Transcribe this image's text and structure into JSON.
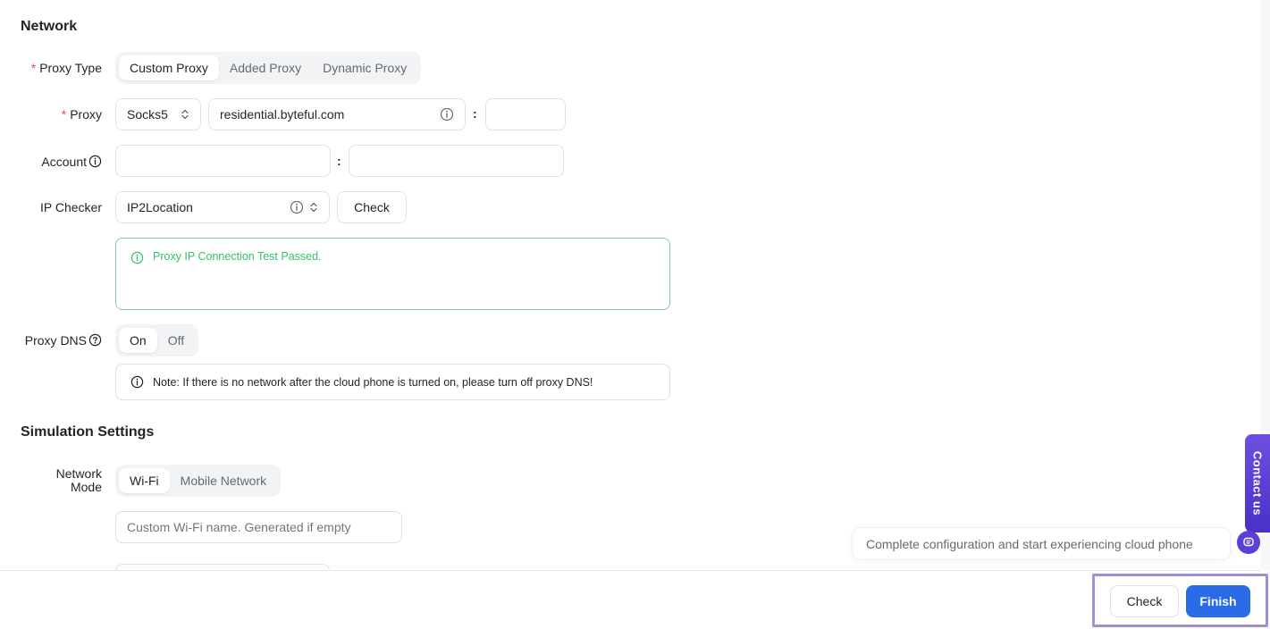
{
  "network": {
    "title": "Network",
    "proxy_type": {
      "label": "Proxy Type",
      "required_mark": "*",
      "options": [
        "Custom Proxy",
        "Added Proxy",
        "Dynamic Proxy"
      ],
      "selected": "Custom Proxy"
    },
    "proxy": {
      "label": "Proxy",
      "required_mark": "*",
      "protocol": "Socks5",
      "host": "residential.byteful.com",
      "port": "",
      "colon": ":"
    },
    "account": {
      "label": "Account",
      "username": "",
      "password": "",
      "colon": ":"
    },
    "ip_checker": {
      "label": "IP Checker",
      "value": "IP2Location",
      "check_label": "Check"
    },
    "test_result": {
      "message": "Proxy IP Connection Test Passed.",
      "color": "#34c26a"
    },
    "proxy_dns": {
      "label": "Proxy DNS",
      "options": [
        "On",
        "Off"
      ],
      "selected": "On",
      "note": "Note: If there is no network after the cloud phone is turned on, please turn off proxy DNS!"
    }
  },
  "simulation": {
    "title": "Simulation Settings",
    "network_mode": {
      "label_line1": "Network",
      "label_line2": "Mode",
      "options": [
        "Wi-Fi",
        "Mobile Network"
      ],
      "selected": "Wi-Fi"
    },
    "wifi_name": {
      "placeholder": "Custom Wi-Fi name. Generated if empty",
      "value": ""
    }
  },
  "footer": {
    "check_label": "Check",
    "finish_label": "Finish",
    "primary_color": "#2a6be6"
  },
  "assistant": {
    "tooltip": "Complete configuration and start experiencing cloud phone",
    "contact_label": "Contact us"
  }
}
